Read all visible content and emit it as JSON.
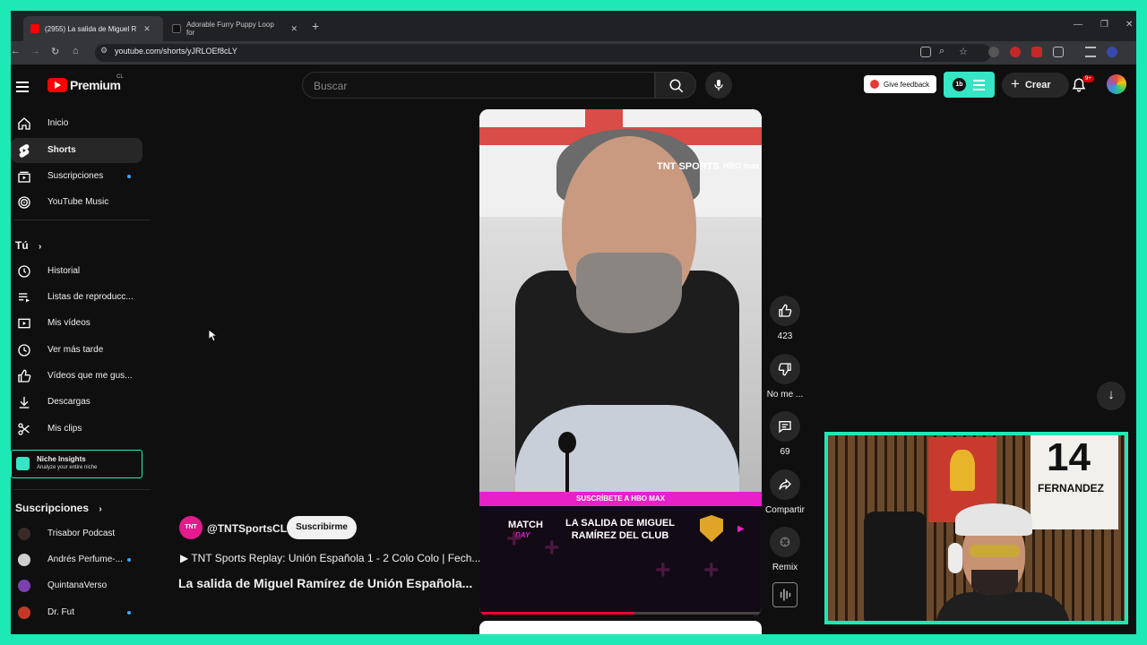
{
  "browser": {
    "tabs": [
      {
        "label": "(2955) La salida de Miguel R",
        "active": true
      },
      {
        "label": "Adorable Furry Puppy Loop for",
        "active": false
      }
    ],
    "url": "youtube.com/shorts/yJRLOEf8cLY"
  },
  "header": {
    "logo_text": "Premium",
    "country": "CL",
    "search_placeholder": "Buscar",
    "feedback_label": "Give feedback",
    "create_label": "Crear",
    "notifications_badge": "9+"
  },
  "sidebar": {
    "main": [
      {
        "label": "Inicio",
        "icon": "home-icon"
      },
      {
        "label": "Shorts",
        "icon": "shorts-icon",
        "active": true
      },
      {
        "label": "Suscripciones",
        "icon": "subscriptions-icon",
        "dot": true
      },
      {
        "label": "YouTube Music",
        "icon": "music-icon"
      }
    ],
    "you_heading": "Tú",
    "you": [
      {
        "label": "Historial",
        "icon": "history-icon"
      },
      {
        "label": "Listas de reproducc...",
        "icon": "playlist-icon"
      },
      {
        "label": "Mis vídeos",
        "icon": "my-videos-icon"
      },
      {
        "label": "Ver más tarde",
        "icon": "watch-later-icon"
      },
      {
        "label": "Vídeos que me gus...",
        "icon": "liked-icon"
      },
      {
        "label": "Descargas",
        "icon": "download-icon"
      },
      {
        "label": "Mis clips",
        "icon": "clips-icon"
      }
    ],
    "niche": {
      "title": "Niche Insights",
      "subtitle": "Analyze your entire niche"
    },
    "subs_heading": "Suscripciones",
    "subs": [
      {
        "label": "Trisabor Podcast",
        "color": "#3a2a2a",
        "dot": false
      },
      {
        "label": "Andrés Perfume-...",
        "color": "#cfcfcf",
        "dot": true
      },
      {
        "label": "QuintanaVerso",
        "color": "#7b3fb0",
        "dot": false
      },
      {
        "label": "Dr. Fut",
        "color": "#c0392b",
        "dot": true
      }
    ]
  },
  "video": {
    "overlay_logo_tnt": "TNT SPORTS",
    "overlay_logo_hbo": "HBO max",
    "subscribe_strip": "SUSCRÍBETE A HBO MAX",
    "matchday": "MATCH",
    "matchday2": "DAY",
    "title": "LA SALIDA DE MIGUEL RAMÍREZ DEL CLUB",
    "progress_percent": 55
  },
  "actions": {
    "likes": "423",
    "dislike_label": "No me ...",
    "comments": "69",
    "share_label": "Compartir",
    "remix_label": "Remix"
  },
  "channel": {
    "avatar_text": "TNT",
    "name": "@TNTSportsCL",
    "subscribe_label": "Suscribirme",
    "related": "▶ TNT Sports Replay: Unión Española 1 - 2 Colo Colo | Fech...",
    "short_title": "La salida de Miguel Ramírez de Unión Española..."
  },
  "webcam": {
    "jersey_number": "14",
    "jersey_name": "FERNANDEZ"
  },
  "colors": {
    "accent": "#1de9b6",
    "yt_red": "#ff0000",
    "hbo_pink": "#e621c9"
  }
}
